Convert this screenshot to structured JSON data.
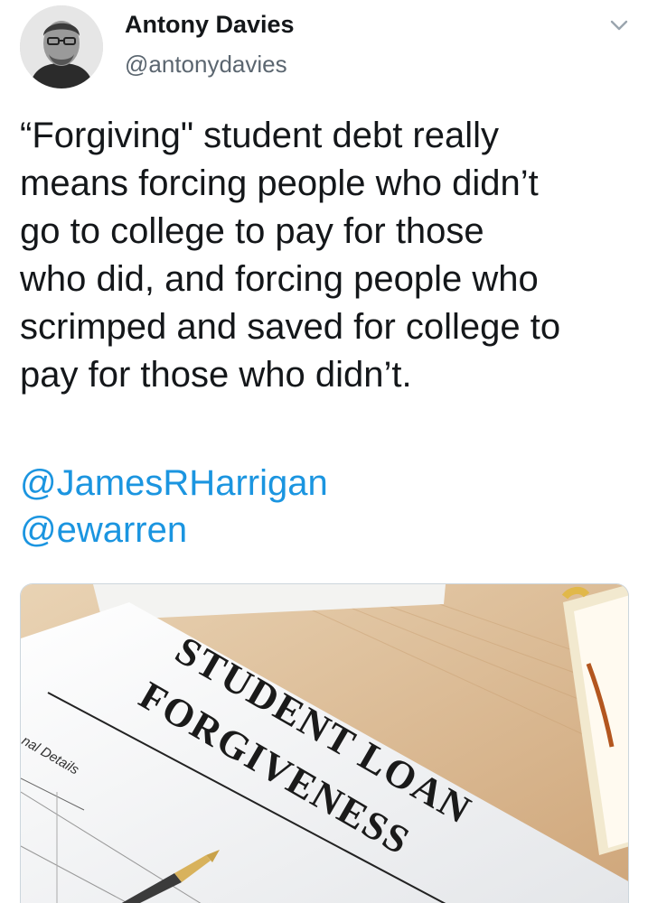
{
  "tweet": {
    "author": {
      "display_name": "Antony Davies",
      "handle": "@antonydavies"
    },
    "text_lines": [
      "“Forgiving\" student debt really",
      "means forcing people who didn’t",
      "go to college to pay for those",
      "who did, and forcing people who",
      "scrimped and saved for college to",
      "pay for those who didn’t."
    ],
    "mentions": [
      "@JamesRHarrigan",
      "@ewarren"
    ],
    "media": {
      "headline_line1": "STUDENT LOAN",
      "headline_line2": "FORGIVENESS",
      "form_label": "nal Details"
    }
  },
  "colors": {
    "link": "#1b95e0",
    "text": "#14171a",
    "secondary": "#5b6670"
  }
}
